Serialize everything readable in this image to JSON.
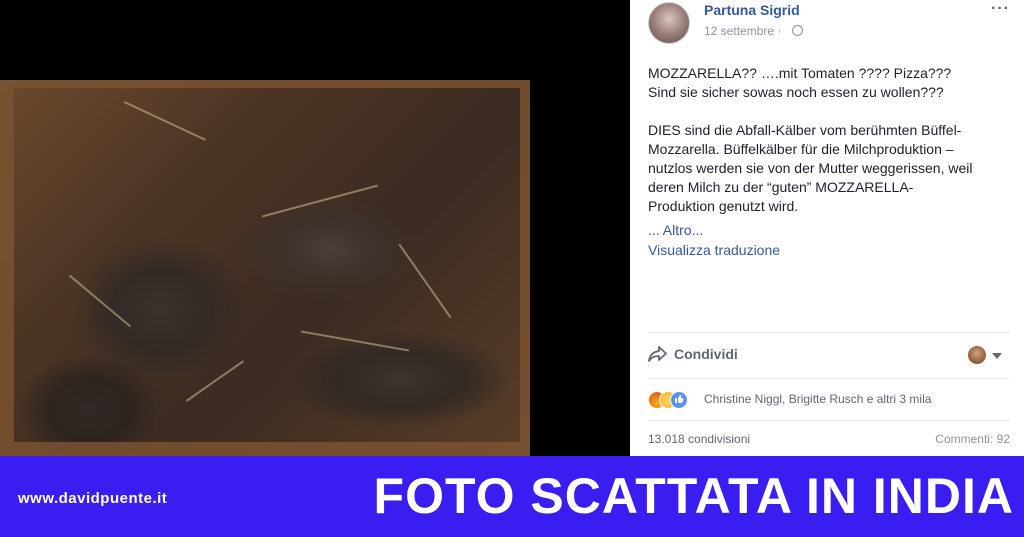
{
  "post": {
    "author": "Partuna Sigrid",
    "date": "12 settembre · ",
    "more_icon": "···",
    "paragraph1_line1": "MOZZARELLA?? ….mit Tomaten ???? Pizza???",
    "paragraph1_line2": "Sind sie sicher sowas noch essen zu wollen???",
    "paragraph2_line1": "DIES sind die Abfall-Kälber vom berühmten Büffel-",
    "paragraph2_line2": "Mozzarella. Büffelkälber für die Milchproduktion –",
    "paragraph2_line3": "nutzlos werden sie von der Mutter weggerissen, weil",
    "paragraph2_line4": "deren Milch zu der “guten” MOZZARELLA-",
    "paragraph2_line5": "Produktion genutzt wird.",
    "more_link": "... Altro...",
    "translate_link": "Visualizza traduzione"
  },
  "actions": {
    "share_label": "Condividi"
  },
  "reactions": {
    "icons": [
      "angry-icon",
      "sad-icon",
      "like-icon"
    ],
    "reactors_text": "Christine Niggl, Brigitte Rusch e altri 3 mila"
  },
  "stats": {
    "shares": "13.018 condivisioni",
    "comments": "Commenti: 92"
  },
  "banner": {
    "site_url": "www.davidpuente.it",
    "headline": "FOTO SCATTATA IN INDIA",
    "color": "#3a1df0"
  },
  "colors": {
    "link": "#365899",
    "text": "#1d2129",
    "muted": "#90949c"
  }
}
